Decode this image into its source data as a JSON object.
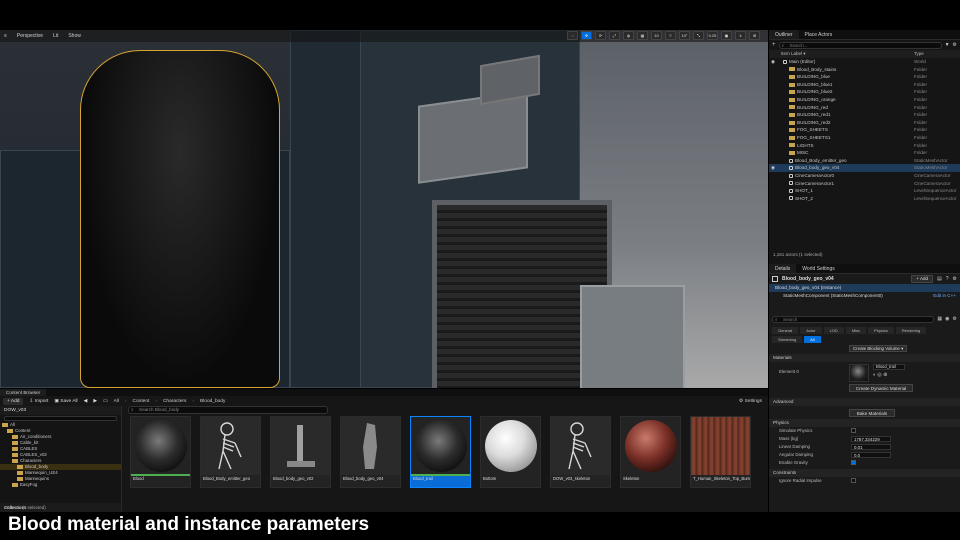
{
  "viewport": {
    "toolbar": [
      "Perspective",
      "Lit",
      "Show"
    ],
    "warning": "",
    "right_tools": [
      "◌",
      "✥",
      "⟳",
      "⤢",
      "◍",
      "▦",
      "10",
      "≡",
      "10°",
      "⤡",
      "0.25",
      "▣",
      "4",
      "⊞"
    ]
  },
  "outliner": {
    "tabs": [
      "Outliner",
      "Place Actors"
    ],
    "search_placeholder": "Search...",
    "columns": {
      "label": "Item Label ▾",
      "type": "Type"
    },
    "rows": [
      {
        "label": "Main (Editor)",
        "type": "World",
        "indent": 1,
        "kind": "world"
      },
      {
        "label": "Blood_Body_stains",
        "type": "Folder",
        "indent": 2,
        "kind": "folder"
      },
      {
        "label": "BUILDING_blue",
        "type": "Folder",
        "indent": 2,
        "kind": "folder"
      },
      {
        "label": "BUILDING_blue1",
        "type": "Folder",
        "indent": 2,
        "kind": "folder"
      },
      {
        "label": "BUILDING_blue2",
        "type": "Folder",
        "indent": 2,
        "kind": "folder"
      },
      {
        "label": "BUILDING_orange",
        "type": "Folder",
        "indent": 2,
        "kind": "folder"
      },
      {
        "label": "BUILDING_red",
        "type": "Folder",
        "indent": 2,
        "kind": "folder"
      },
      {
        "label": "BUILDING_red1",
        "type": "Folder",
        "indent": 2,
        "kind": "folder"
      },
      {
        "label": "BUILDING_red2",
        "type": "Folder",
        "indent": 2,
        "kind": "folder"
      },
      {
        "label": "FOG_SHEETS",
        "type": "Folder",
        "indent": 2,
        "kind": "folder"
      },
      {
        "label": "FOG_SHEETS1",
        "type": "Folder",
        "indent": 2,
        "kind": "folder"
      },
      {
        "label": "LIGHTS",
        "type": "Folder",
        "indent": 2,
        "kind": "folder"
      },
      {
        "label": "MISC",
        "type": "Folder",
        "indent": 2,
        "kind": "folder"
      },
      {
        "label": "Blood_Body_emitter_geo",
        "type": "StaticMeshActor",
        "indent": 2,
        "kind": "mesh"
      },
      {
        "label": "Blood_body_geo_v04",
        "type": "StaticMeshActor",
        "indent": 2,
        "kind": "mesh",
        "selected": true
      },
      {
        "label": "CineCameraActor0",
        "type": "CineCameraActor",
        "indent": 2,
        "kind": "mesh"
      },
      {
        "label": "CineCameraActor1",
        "type": "CineCameraActor",
        "indent": 2,
        "kind": "mesh"
      },
      {
        "label": "SHOT_1",
        "type": "LevelSequenceActor",
        "indent": 2,
        "kind": "mesh"
      },
      {
        "label": "SHOT_2",
        "type": "LevelSequenceActor",
        "indent": 2,
        "kind": "mesh"
      }
    ],
    "status": "1,161 actors (1 selected)"
  },
  "details": {
    "tabs": [
      "Details",
      "World Settings"
    ],
    "title": "Blood_body_geo_v04",
    "add_label": "+ Add",
    "components": [
      {
        "label": "Blood_body_geo_v04 (Instance)",
        "selected": true
      },
      {
        "label": "StaticMeshComponent (StaticMeshComponent0)",
        "selected": false
      }
    ],
    "edit_link": "Edit in C++",
    "search_placeholder": "Search",
    "categories": [
      "General",
      "Actor",
      "LOD",
      "Misc",
      "Physics",
      "Rendering",
      "Streaming",
      "All"
    ],
    "blocking_volume": "Create Blocking Volume ▾",
    "materials_section": "Materials",
    "element_label": "Element 0",
    "material_name": "Blood_trail",
    "dynamic_btn": "Create Dynamic Material",
    "advanced_section": "Advanced",
    "bake_btn": "Bake Materials",
    "physics_section": "Physics",
    "physics_props": [
      {
        "name": "Simulate Physics",
        "kind": "check",
        "on": false
      },
      {
        "name": "Mass (kg)",
        "kind": "num",
        "value": "1787.334229"
      },
      {
        "name": "Linear Damping",
        "kind": "num",
        "value": "0.01"
      },
      {
        "name": "Angular Damping",
        "kind": "num",
        "value": "0.0"
      },
      {
        "name": "Enable Gravity",
        "kind": "check",
        "on": true
      }
    ],
    "constraints_section": "Constraints",
    "ignore_label": "Ignore Radial Impulse"
  },
  "content_browser": {
    "tab": "Content Browser",
    "toolbar": {
      "add": "+ Add",
      "import": "Import",
      "save_all": "Save All",
      "settings": "Settings"
    },
    "breadcrumbs": [
      "All",
      "Content",
      "Characters",
      "Blood_body"
    ],
    "project": "DOW_v03",
    "search_placeholder": "Search Blood_body",
    "tree": [
      {
        "label": "All",
        "indent": 0
      },
      {
        "label": "Content",
        "indent": 1
      },
      {
        "label": "Air_conditioners",
        "indent": 2
      },
      {
        "label": "Cable_kit",
        "indent": 2
      },
      {
        "label": "CABLES",
        "indent": 2
      },
      {
        "label": "CABLES_v02",
        "indent": 2
      },
      {
        "label": "Characters",
        "indent": 2
      },
      {
        "label": "Blood_body",
        "indent": 3,
        "selected": true
      },
      {
        "label": "Mannequin_UE4",
        "indent": 3
      },
      {
        "label": "Mannequins",
        "indent": 3
      },
      {
        "label": "EasyFog",
        "indent": 2
      }
    ],
    "collections": "Collections",
    "assets": [
      {
        "label": "Blood",
        "thumb": "sphere-dark",
        "bar": true
      },
      {
        "label": "Blood_Body_emitter_geo",
        "thumb": "skeleton"
      },
      {
        "label": "Blood_body_geo_v02",
        "thumb": "pillar"
      },
      {
        "label": "Blood_body_geo_v04",
        "thumb": "figure"
      },
      {
        "label": "Blood_trail",
        "thumb": "sphere-dark",
        "selected": true,
        "bar": true
      },
      {
        "label": "Bottom",
        "thumb": "sphere-white"
      },
      {
        "label": "DOW_v03_skeleton",
        "thumb": "skeleton"
      },
      {
        "label": "Skeleton",
        "thumb": "sphere-rust"
      },
      {
        "label": "T_Human_Skeleton_Top_Burnt_Blendr_a",
        "thumb": "tex-rust"
      }
    ],
    "status": "18 items (1 selected)"
  },
  "caption": "Blood material and instance parameters",
  "colors": {
    "accent": "#0070e0",
    "selection": "#1e3b5c",
    "folder": "#c9a44c",
    "outline": "#d7a531"
  }
}
